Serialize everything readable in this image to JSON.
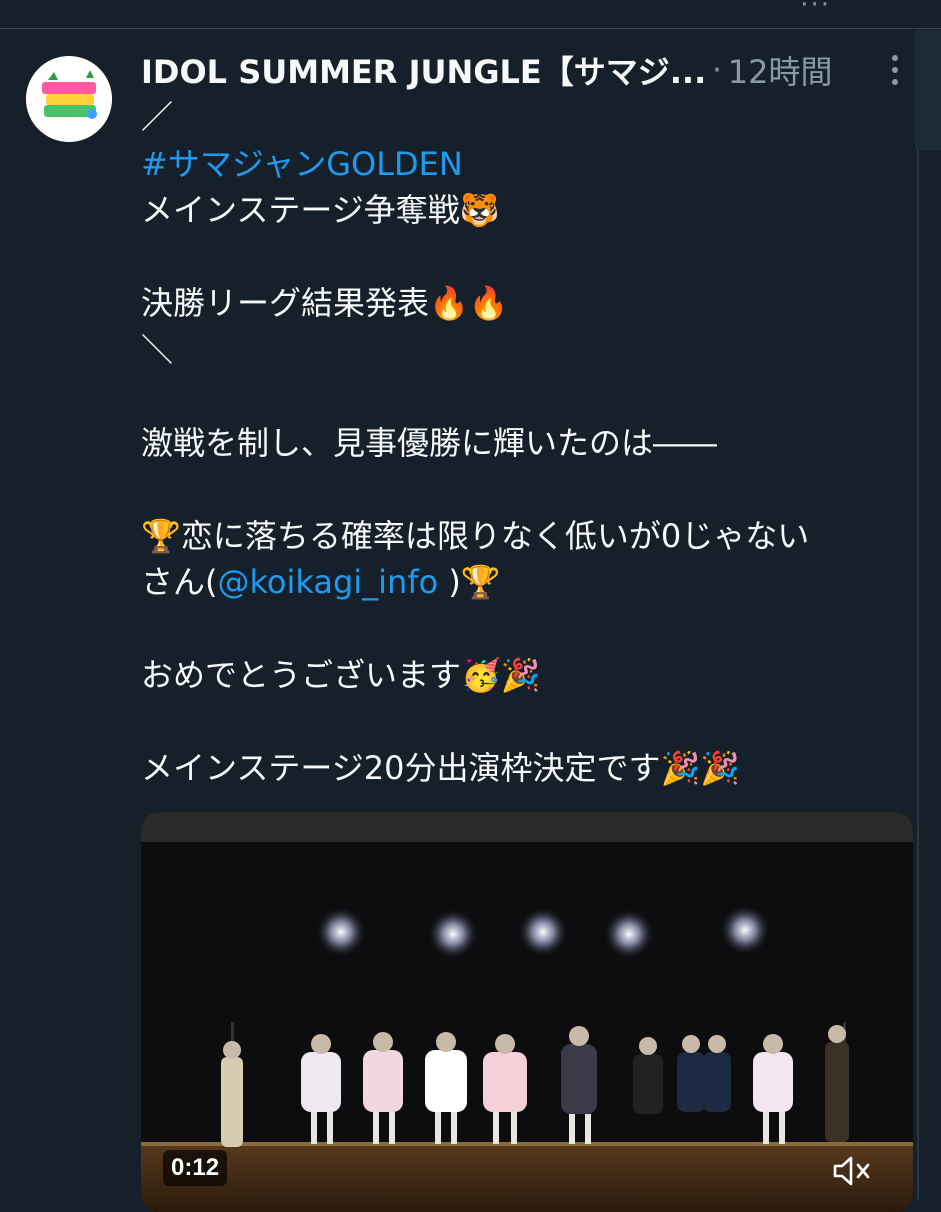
{
  "post": {
    "display_name": "IDOL SUMMER JUNGLE【サマジ...",
    "separator": "·",
    "timestamp": "12時間",
    "more_label": "⋮",
    "lines": {
      "l1": "／",
      "l2_hashtag": "#サマジャンGOLDEN",
      "l3": "メインステージ争奪戦",
      "l5": "決勝リーグ結果発表",
      "l6": "＼",
      "l8": "激戦を制し、見事優勝に輝いたのは――",
      "l10": "恋に落ちる確率は限りなく低いが0じゃない",
      "l11_pre": "さん(",
      "l11_mention": "@koikagi_info",
      "l11_post": " )",
      "l13": "おめでとうございます",
      "l15": "メインステージ20分出演枠決定です"
    },
    "emoji": {
      "tiger": "🐯",
      "fire": "🔥",
      "trophy": "🏆",
      "partying_face": "🥳",
      "party_popper": "🎉"
    }
  },
  "video": {
    "time": "0:12",
    "mute_icon": "speaker-muted-icon"
  },
  "colors": {
    "background": "#15202b",
    "text": "#f7f9f9",
    "secondary": "#8b98a5",
    "link": "#1d9bf0"
  }
}
